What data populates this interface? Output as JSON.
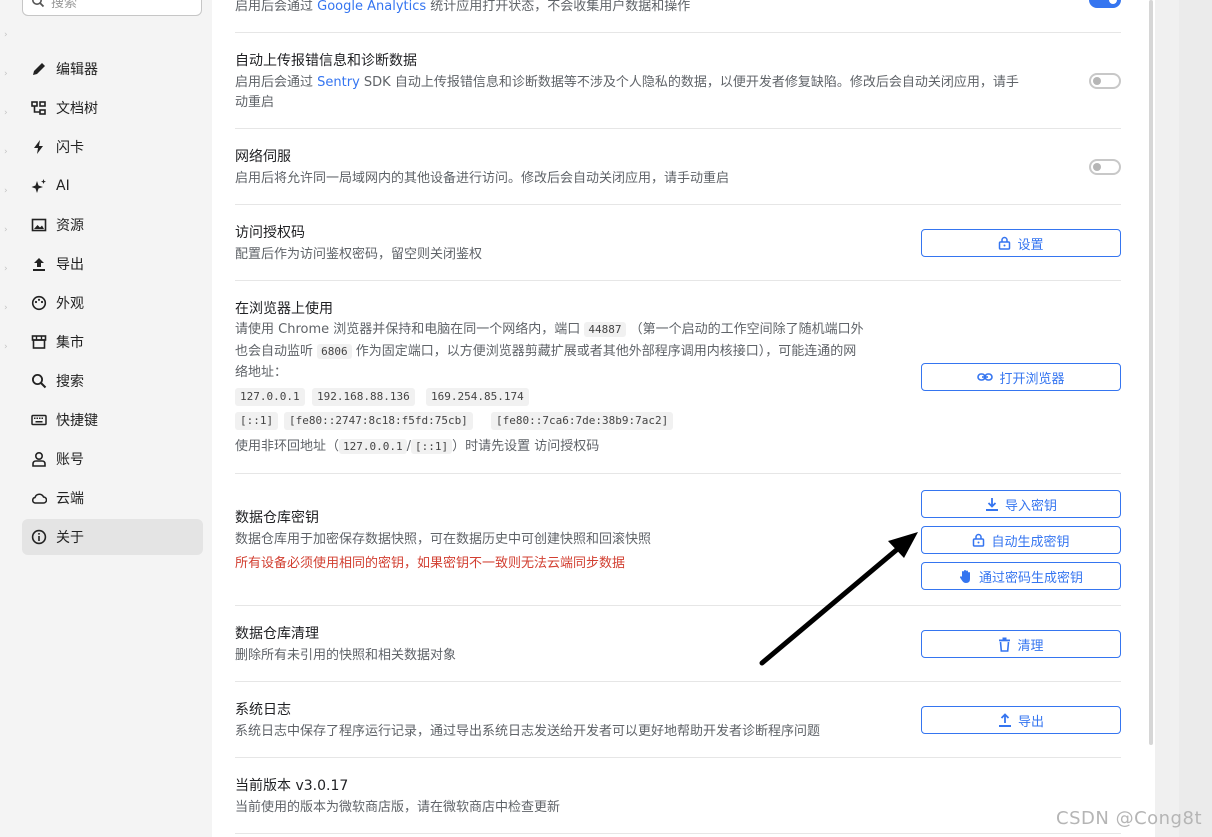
{
  "sidebar": {
    "search_placeholder": "搜索",
    "items": [
      {
        "label": "编辑器",
        "icon": "pencil-icon"
      },
      {
        "label": "文档树",
        "icon": "tree-icon"
      },
      {
        "label": "闪卡",
        "icon": "flash-icon"
      },
      {
        "label": "AI",
        "icon": "sparkle-icon"
      },
      {
        "label": "资源",
        "icon": "image-icon"
      },
      {
        "label": "导出",
        "icon": "upload-icon"
      },
      {
        "label": "外观",
        "icon": "palette-icon"
      },
      {
        "label": "集市",
        "icon": "store-icon"
      },
      {
        "label": "搜索",
        "icon": "search-icon"
      },
      {
        "label": "快捷键",
        "icon": "keyboard-icon"
      },
      {
        "label": "账号",
        "icon": "user-icon"
      },
      {
        "label": "云端",
        "icon": "cloud-icon"
      },
      {
        "label": "关于",
        "icon": "info-icon"
      }
    ],
    "active_index": 12
  },
  "about": {
    "analytics": {
      "desc_prefix": "启用后会通过 ",
      "desc_link": "Google Analytics",
      "desc_suffix": " 统计应用打开状态，不会收集用户数据和操作",
      "enabled": true
    },
    "error_report": {
      "title": "自动上传报错信息和诊断数据",
      "desc_prefix": "启用后会通过 ",
      "desc_link": "Sentry",
      "desc_line1_suffix": " SDK 自动上传报错信息和诊断数据等不涉及个人隐私的数据，以便开发者修复缺陷。修改后会自动关闭应用，请手",
      "desc_line2": "动重启",
      "enabled": false
    },
    "network_serve": {
      "title": "网络伺服",
      "desc": "启用后将允许同一局域网内的其他设备进行访问。修改后会自动关闭应用，请手动重启",
      "enabled": false
    },
    "auth_code": {
      "title": "访问授权码",
      "desc": "配置后作为访问鉴权密码，留空则关闭鉴权",
      "button": "设置"
    },
    "browser": {
      "title": "在浏览器上使用",
      "line1_a": "请使用 Chrome 浏览器并保持和电脑在同一个网络内，端口",
      "port": "44887",
      "line1_b": "（第一个启动的工作空间除了随机端口外",
      "line2_a": "也会自动监听",
      "fixed_port": "6806",
      "line2_b": "作为固定端口，以方便浏览器剪藏扩展或者其他外部程序调用内核接口），可能连通的网",
      "line3": "络地址：",
      "addresses_row1": [
        "127.0.0.1",
        "192.168.88.136",
        "169.254.85.174"
      ],
      "addresses_row2": [
        "[::1]",
        "[fe80::2747:8c18:f5fd:75cb]",
        "[fe80::7ca6:7de:38b9:7ac2]"
      ],
      "note_a": "使用非环回地址（",
      "note_addr1": "127.0.0.1",
      "note_sep": "/",
      "note_addr2": "[::1]",
      "note_b": "）时请先设置 访问授权码",
      "button": "打开浏览器"
    },
    "repo_key": {
      "title": "数据仓库密钥",
      "desc": "数据仓库用于加密保存数据快照，可在数据历史中可创建快照和回滚快照",
      "warning": "所有设备必须使用相同的密钥，如果密钥不一致则无法云端同步数据",
      "btn_import": "导入密钥",
      "btn_auto": "自动生成密钥",
      "btn_password": "通过密码生成密钥"
    },
    "repo_clean": {
      "title": "数据仓库清理",
      "desc": "删除所有未引用的快照和相关数据对象",
      "button": "清理"
    },
    "syslog": {
      "title": "系统日志",
      "desc": "系统日志中保存了程序运行记录，通过导出系统日志发送给开发者可以更好地帮助开发者诊断程序问题",
      "button": "导出"
    },
    "version": {
      "title": "当前版本 v3.0.17",
      "desc": "当前使用的版本为微软商店版，请在微软商店中检查更新"
    }
  },
  "watermark": "CSDN @Cong8t",
  "colors": {
    "accent": "#3575f0",
    "warning": "#d23f31"
  }
}
